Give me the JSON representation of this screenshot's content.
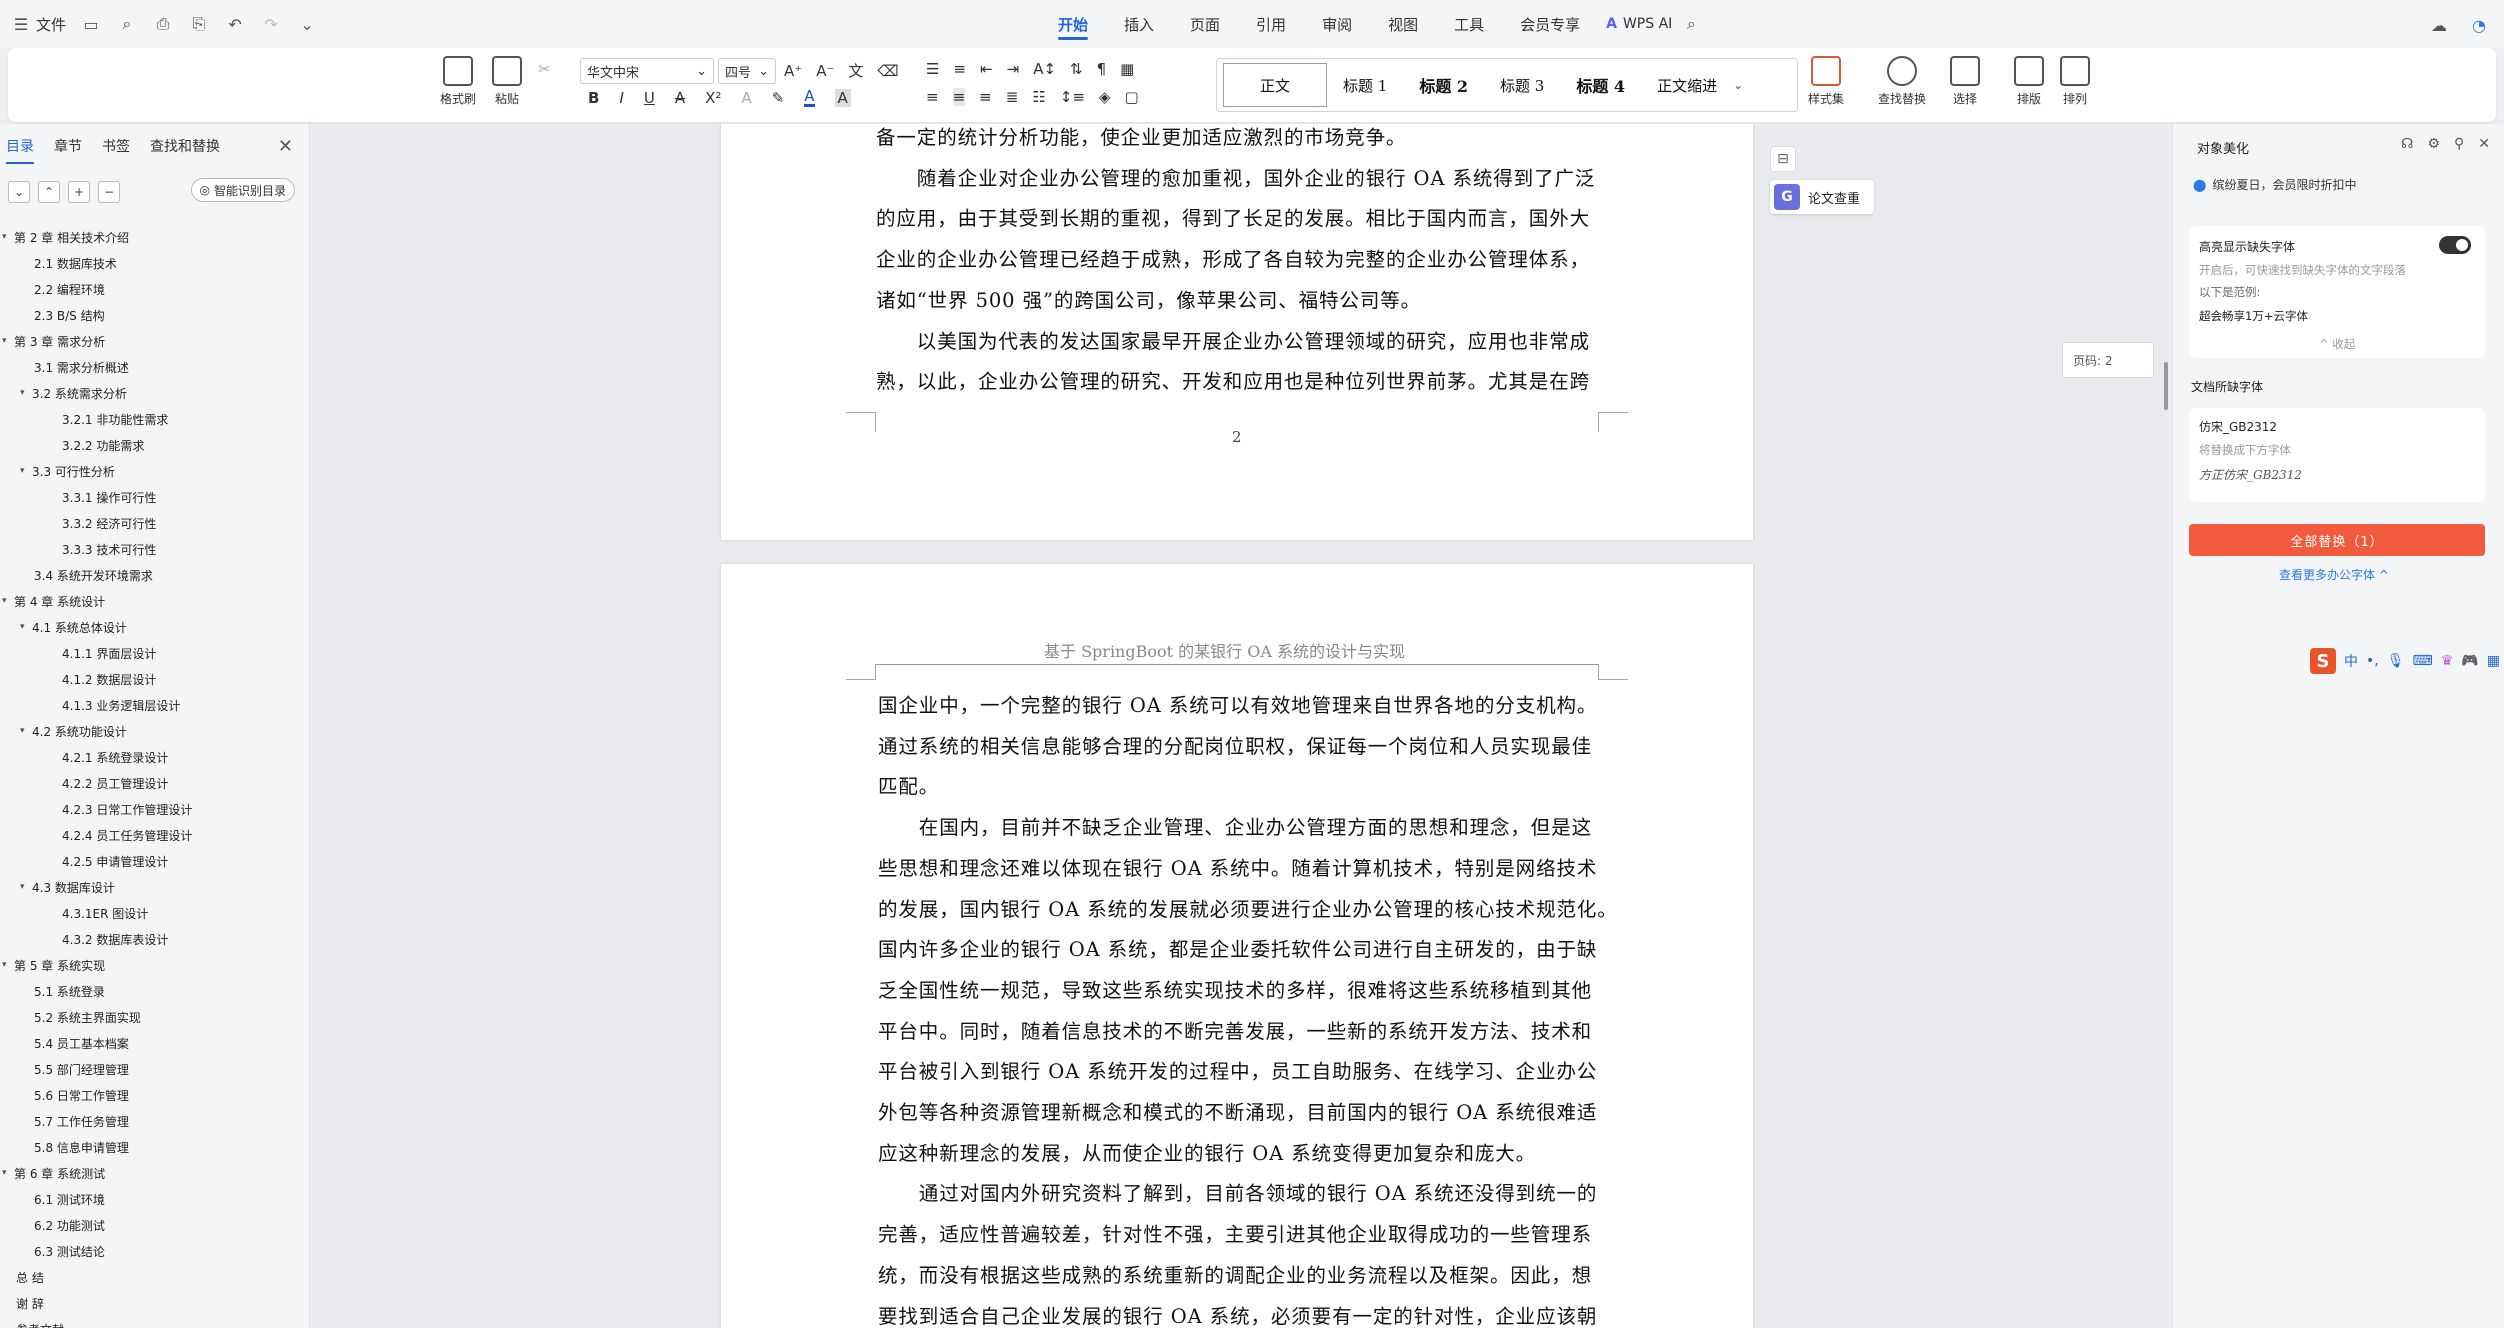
{
  "menubar": {
    "file_label": "文件",
    "tabs": [
      "开始",
      "插入",
      "页面",
      "引用",
      "审阅",
      "视图",
      "工具",
      "会员专享"
    ],
    "active_tab": "开始",
    "wps_ai_label": "WPS AI"
  },
  "ribbon": {
    "format_painter": "格式刷",
    "paste": "粘贴",
    "font_name": "华文中宋",
    "font_size": "四号",
    "styles": [
      "正文",
      "标题 1",
      "标题 2",
      "标题 3",
      "标题 4",
      "正文缩进"
    ],
    "style_set": "样式集",
    "find_replace": "查找替换",
    "select": "选择",
    "layout": "排版",
    "arrange": "排列"
  },
  "left_pane": {
    "tabs": [
      "目录",
      "章节",
      "书签",
      "查找和替换"
    ],
    "active_tab": "目录",
    "smart_toc": "智能识别目录",
    "toc": [
      {
        "level": 1,
        "text": "第 2 章  相关技术介绍",
        "caret": true
      },
      {
        "level": 2,
        "text": "2.1  数据库技术"
      },
      {
        "level": 2,
        "text": "2.2  编程环境"
      },
      {
        "level": 2,
        "text": "2.3 B/S 结构"
      },
      {
        "level": 1,
        "text": "第 3 章  需求分析",
        "caret": true
      },
      {
        "level": 2,
        "text": "3.1  需求分析概述"
      },
      {
        "level": 2,
        "text": "3.2  系统需求分析",
        "caret": true
      },
      {
        "level": 3,
        "text": "3.2.1 非功能性需求"
      },
      {
        "level": 3,
        "text": "3.2.2 功能需求"
      },
      {
        "level": 2,
        "text": "3.3  可行性分析",
        "caret": true
      },
      {
        "level": 3,
        "text": "3.3.1 操作可行性"
      },
      {
        "level": 3,
        "text": "3.3.2 经济可行性"
      },
      {
        "level": 3,
        "text": "3.3.3 技术可行性"
      },
      {
        "level": 2,
        "text": "3.4  系统开发环境需求"
      },
      {
        "level": 1,
        "text": "第 4 章  系统设计",
        "caret": true
      },
      {
        "level": 2,
        "text": "4.1 系统总体设计",
        "caret": true
      },
      {
        "level": 3,
        "text": "4.1.1 界面层设计"
      },
      {
        "level": 3,
        "text": "4.1.2 数据层设计"
      },
      {
        "level": 3,
        "text": "4.1.3 业务逻辑层设计"
      },
      {
        "level": 2,
        "text": "4.2 系统功能设计",
        "caret": true
      },
      {
        "level": 3,
        "text": "4.2.1 系统登录设计"
      },
      {
        "level": 3,
        "text": "4.2.2 员工管理设计"
      },
      {
        "level": 3,
        "text": "4.2.3 日常工作管理设计"
      },
      {
        "level": 3,
        "text": "4.2.4 员工任务管理设计"
      },
      {
        "level": 3,
        "text": "4.2.5 申请管理设计"
      },
      {
        "level": 2,
        "text": "4.3  数据库设计",
        "caret": true
      },
      {
        "level": 3,
        "text": "4.3.1ER 图设计"
      },
      {
        "level": 3,
        "text": "4.3.2 数据库表设计"
      },
      {
        "level": 1,
        "text": "第 5 章  系统实现",
        "caret": true
      },
      {
        "level": 2,
        "text": "5.1 系统登录"
      },
      {
        "level": 2,
        "text": "5.2 系统主界面实现"
      },
      {
        "level": 2,
        "text": "5.4 员工基本档案"
      },
      {
        "level": 2,
        "text": "5.5 部门经理管理"
      },
      {
        "level": 2,
        "text": "5.6 日常工作管理"
      },
      {
        "level": 2,
        "text": "5.7 工作任务管理"
      },
      {
        "level": 2,
        "text": "5.8 信息申请管理"
      },
      {
        "level": 1,
        "text": "第 6 章  系统测试",
        "caret": true
      },
      {
        "level": 2,
        "text": "6.1  测试环境"
      },
      {
        "level": 2,
        "text": "6.2  功能测试"
      },
      {
        "level": 2,
        "text": "6.3  测试结论"
      },
      {
        "level": 1,
        "text": "总  结"
      },
      {
        "level": 1,
        "text": "谢  辞"
      },
      {
        "level": 1,
        "text": "参考文献"
      }
    ]
  },
  "document": {
    "page1_lines": [
      "备一定的统计分析功能，使企业更加适应激烈的市场竞争。",
      "　　随着企业对企业办公管理的愈加重视，国外企业的银行 OA 系统得到了广泛",
      "的应用，由于其受到长期的重视，得到了长足的发展。相比于国内而言，国外大",
      "企业的企业办公管理已经趋于成熟，形成了各自较为完整的企业办公管理体系，",
      "诸如“世界 500 强”的跨国公司，像苹果公司、福特公司等。",
      "　　以美国为代表的发达国家最早开展企业办公管理领域的研究，应用也非常成",
      "熟，以此，企业办公管理的研究、开发和应用也是种位列世界前茅。尤其是在跨"
    ],
    "page1_number": "2",
    "page2_header": "基于 SpringBoot 的某银行 OA 系统的设计与实现",
    "page2_lines": [
      "国企业中，一个完整的银行 OA 系统可以有效地管理来自世界各地的分支机构。",
      "通过系统的相关信息能够合理的分配岗位职权，保证每一个岗位和人员实现最佳",
      "匹配。",
      "　　在国内，目前并不缺乏企业管理、企业办公管理方面的思想和理念，但是这",
      "些思想和理念还难以体现在银行 OA 系统中。随着计算机技术，特别是网络技术",
      "的发展，国内银行 OA 系统的发展就必须要进行企业办公管理的核心技术规范化。",
      "国内许多企业的银行 OA 系统，都是企业委托软件公司进行自主研发的，由于缺",
      "乏全国性统一规范，导致这些系统实现技术的多样，很难将这些系统移植到其他",
      "平台中。同时，随着信息技术的不断完善发展，一些新的系统开发方法、技术和",
      "平台被引入到银行 OA 系统开发的过程中，员工自助服务、在线学习、企业办公",
      "外包等各种资源管理新概念和模式的不断涌现，目前国内的银行 OA 系统很难适",
      "应这种新理念的发展，从而使企业的银行 OA 系统变得更加复杂和庞大。",
      "　　通过对国内外研究资料了解到，目前各领域的银行 OA 系统还没得到统一的",
      "完善，适应性普遍较差，针对性不强，主要引进其他企业取得成功的一些管理系",
      "统，而没有根据这些成熟的系统重新的调配企业的业务流程以及框架。因此，想",
      "要找到适合自己企业发展的银行 OA 系统，必须要有一定的针对性，企业应该朝"
    ],
    "lunwen_check": "论文查重",
    "page_tip": "页码: 2"
  },
  "right_pane": {
    "title": "对象美化",
    "promo": "缤纷夏日，会员限时折扣中",
    "highlight_title": "高亮显示缺失字体",
    "highlight_desc": "开启后，可快速找到缺失字体的文字段落",
    "scope_label": "以下是范例:",
    "scope_value": "超会畅享1万+云字体",
    "collapse": "收起",
    "missing_title": "文档所缺字体",
    "missing_font": "仿宋_GB2312",
    "replace_hint": "将替换成下方字体",
    "replacement_font": "方正仿宋_GB2312",
    "replace_all": "全部替换（1）",
    "more_fonts": "查看更多办公字体"
  },
  "ime": {
    "lang": "中"
  }
}
